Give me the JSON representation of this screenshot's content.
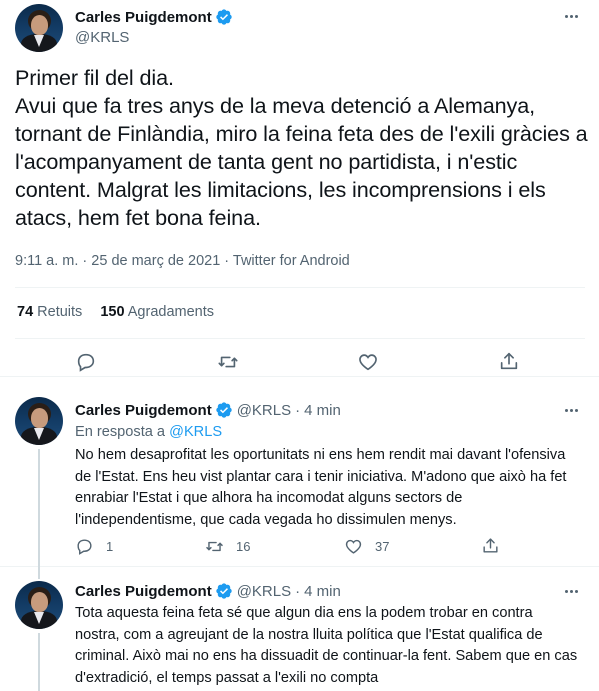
{
  "main_tweet": {
    "author_name": "Carles Puigdemont",
    "author_handle": "@KRLS",
    "text": "Primer fil del dia.\nAvui que fa tres anys de la meva detenció a Alemanya, tornant de Finlàndia, miro la feina feta des de l'exili gràcies a l'acompanyament de tanta gent no partidista, i n'estic content. Malgrat les limitacions, les incomprensions i els atacs, hem fet bona feina.",
    "meta": "9:11 a. m. · 25 de març de 2021 · Twitter for Android",
    "retweets_count": "74",
    "retweets_label": "Retuits",
    "likes_count": "150",
    "likes_label": "Agradaments"
  },
  "replies": [
    {
      "author_name": "Carles Puigdemont",
      "author_handle": "@KRLS",
      "time": "4 min",
      "reply_to_prefix": "En resposta a",
      "reply_to_handle": "@KRLS",
      "text": "No hem desaprofitat les oportunitats ni ens hem rendit mai davant l'ofensiva de l'Estat. Ens heu vist plantar cara i tenir iniciativa. M'adono que això ha fet enrabiar l'Estat i que alhora ha incomodat alguns sectors de l'independentisme, que cada vegada ho dissimulen menys.",
      "reply_count": "1",
      "retweet_count": "16",
      "like_count": "37"
    },
    {
      "author_name": "Carles Puigdemont",
      "author_handle": "@KRLS",
      "time": "4 min",
      "text": "Tota aquesta feina feta sé que algun dia ens la podem trobar en contra nostra, com a agreujant de la nostra lluita política que l'Estat qualifica de criminal. Això mai no ens ha dissuadit de continuar-la fent. Sabem que en cas d'extradició, el temps passat a l'exili no compta"
    }
  ],
  "icons": {
    "verified": "verified-badge-icon",
    "more": "more-options-icon",
    "reply": "reply-icon",
    "retweet": "retweet-icon",
    "like": "heart-icon",
    "share": "share-icon"
  },
  "colors": {
    "accent": "#1d9bf0",
    "text": "#0f1419",
    "secondary": "#536471",
    "divider": "#eff3f4"
  }
}
